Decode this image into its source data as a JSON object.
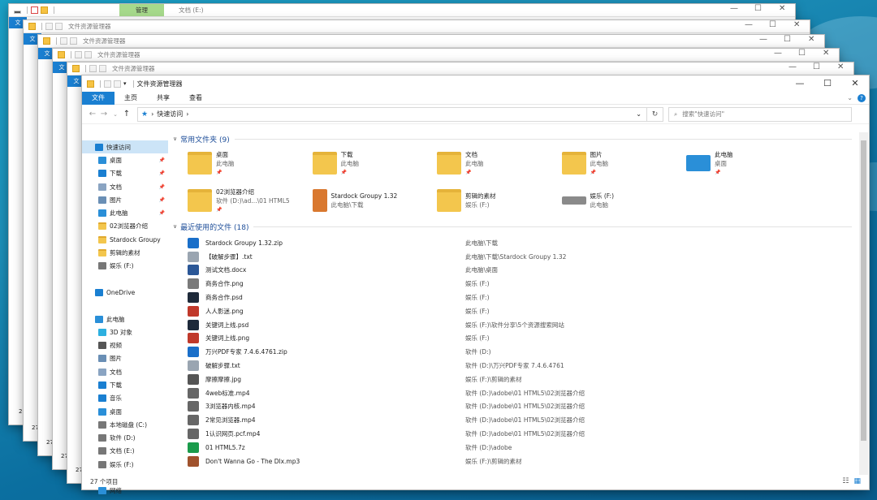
{
  "colors": {
    "accent": "#1a7fd1",
    "group_header": "#1e4e99",
    "manage_tab": "#a6d98b"
  },
  "back_window": {
    "manage_label": "管理",
    "title": "文档 (E:)"
  },
  "stack_tab": "文",
  "stack_title": "文件资源管理器",
  "main": {
    "title": "文件资源管理器",
    "ribbon_tabs": [
      "文件",
      "主页",
      "共享",
      "查看"
    ],
    "address": {
      "back": "←",
      "forward": "→",
      "recent": "⌄",
      "up": "↑",
      "path_root": "快速访问",
      "path_chevron": "›",
      "dropdown": "⌄",
      "refresh": "↻",
      "search_placeholder": "搜索\"快速访问\""
    },
    "controls": {
      "minimize": "—",
      "maximize": "☐",
      "close": "✕"
    }
  },
  "sidebar": {
    "items": [
      {
        "label": "快速访问",
        "icon": "star-icon",
        "pinned": false,
        "selected": true
      },
      {
        "label": "桌面",
        "icon": "desktop-icon",
        "pinned": true
      },
      {
        "label": "下载",
        "icon": "download-icon",
        "pinned": true
      },
      {
        "label": "文档",
        "icon": "document-icon",
        "pinned": true
      },
      {
        "label": "图片",
        "icon": "picture-icon",
        "pinned": true
      },
      {
        "label": "此电脑",
        "icon": "computer-icon",
        "pinned": true
      },
      {
        "label": "02浏览器介绍",
        "icon": "folder-icon"
      },
      {
        "label": "Stardock Groupy",
        "icon": "folder-icon"
      },
      {
        "label": "剪辑的素材",
        "icon": "folder-icon"
      },
      {
        "label": "娱乐 (F:)",
        "icon": "drive-icon"
      },
      {
        "label": "",
        "icon": ""
      },
      {
        "label": "OneDrive",
        "icon": "cloud-icon"
      },
      {
        "label": "",
        "icon": ""
      },
      {
        "label": "此电脑",
        "icon": "computer-icon"
      },
      {
        "label": "3D 对象",
        "icon": "cube-icon"
      },
      {
        "label": "视频",
        "icon": "video-icon"
      },
      {
        "label": "图片",
        "icon": "picture-icon"
      },
      {
        "label": "文档",
        "icon": "document-icon"
      },
      {
        "label": "下载",
        "icon": "download-icon"
      },
      {
        "label": "音乐",
        "icon": "music-icon"
      },
      {
        "label": "桌面",
        "icon": "desktop-icon"
      },
      {
        "label": "本地磁盘 (C:)",
        "icon": "drive-icon"
      },
      {
        "label": "软件 (D:)",
        "icon": "drive-icon"
      },
      {
        "label": "文档 (E:)",
        "icon": "drive-icon"
      },
      {
        "label": "娱乐 (F:)",
        "icon": "drive-icon"
      },
      {
        "label": "",
        "icon": ""
      },
      {
        "label": "网络",
        "icon": "network-icon"
      }
    ]
  },
  "frequent": {
    "header": "常用文件夹 (9)",
    "tiles": [
      {
        "name": "桌面",
        "sub": "此电脑",
        "pin": "📌"
      },
      {
        "name": "下载",
        "sub": "此电脑",
        "pin": "📌"
      },
      {
        "name": "文档",
        "sub": "此电脑",
        "pin": "📌"
      },
      {
        "name": "图片",
        "sub": "此电脑",
        "pin": "📌"
      },
      {
        "name": "此电脑",
        "sub": "桌面",
        "pin": "📌"
      },
      {
        "name": "02浏览器介绍",
        "sub": "软件 (D:)\\ad...\\01 HTML5",
        "pin": "📌"
      },
      {
        "name": "Stardock Groupy 1.32",
        "sub": "此电脑\\下载",
        "pin": ""
      },
      {
        "name": "剪辑的素材",
        "sub": "娱乐 (F:)",
        "pin": ""
      },
      {
        "name": "娱乐 (F:)",
        "sub": "此电脑",
        "pin": ""
      }
    ]
  },
  "recent": {
    "header": "最近使用的文件 (18)",
    "rows": [
      {
        "name": "Stardock Groupy 1.32.zip",
        "path": "此电脑\\下载",
        "icon": "zip-icon",
        "color": "#1a6fc9"
      },
      {
        "name": "【破解步骤】.txt",
        "path": "此电脑\\下载\\Stardock Groupy 1.32",
        "icon": "txt-icon",
        "color": "#9aa5b1"
      },
      {
        "name": "测试文档.docx",
        "path": "此电脑\\桌面",
        "icon": "word-icon",
        "color": "#2b5797"
      },
      {
        "name": "商务合作.png",
        "path": "娱乐 (F:)",
        "icon": "png-icon",
        "color": "#7a7a7a"
      },
      {
        "name": "商务合作.psd",
        "path": "娱乐 (F:)",
        "icon": "psd-icon",
        "color": "#1e2a3a"
      },
      {
        "name": "人人影迷.png",
        "path": "娱乐 (F:)",
        "icon": "png-icon",
        "color": "#c0392b"
      },
      {
        "name": "关键词上线.psd",
        "path": "娱乐 (F:)\\软件分享\\5个资源搜索网站",
        "icon": "psd-icon",
        "color": "#1e2a3a"
      },
      {
        "name": "关键词上线.png",
        "path": "娱乐 (F:)",
        "icon": "png-icon",
        "color": "#c0392b"
      },
      {
        "name": "万兴PDF专家 7.4.6.4761.zip",
        "path": "软件 (D:)",
        "icon": "zip-icon",
        "color": "#1a6fc9"
      },
      {
        "name": "破解步骤.txt",
        "path": "软件 (D:)\\万兴PDF专家 7.4.6.4761",
        "icon": "txt-icon",
        "color": "#9aa5b1"
      },
      {
        "name": "摩擦摩擦.jpg",
        "path": "娱乐 (F:)\\剪辑的素材",
        "icon": "jpg-icon",
        "color": "#555"
      },
      {
        "name": "4web标准.mp4",
        "path": "软件 (D:)\\adobe\\01 HTML5\\02浏览器介绍",
        "icon": "video-icon",
        "color": "#666"
      },
      {
        "name": "3浏览器内核.mp4",
        "path": "软件 (D:)\\adobe\\01 HTML5\\02浏览器介绍",
        "icon": "video-icon",
        "color": "#666"
      },
      {
        "name": "2常见浏览器.mp4",
        "path": "软件 (D:)\\adobe\\01 HTML5\\02浏览器介绍",
        "icon": "video-icon",
        "color": "#666"
      },
      {
        "name": "1认识网页.pcf.mp4",
        "path": "软件 (D:)\\adobe\\01 HTML5\\02浏览器介绍",
        "icon": "video-icon",
        "color": "#666"
      },
      {
        "name": "01 HTML5.7z",
        "path": "软件 (D:)\\adobe",
        "icon": "7z-icon",
        "color": "#1a9b4b"
      },
      {
        "name": "Don't Wanna Go  - The Dlx.mp3",
        "path": "娱乐 (F:)\\剪辑的素材",
        "icon": "audio-icon",
        "color": "#a0522d"
      }
    ]
  },
  "status": {
    "count": "27 个项目"
  },
  "stack_counts": [
    "20",
    "27",
    "27",
    "27",
    "27",
    "27"
  ],
  "view_icons": {
    "details": "☷",
    "tiles": "▦"
  },
  "help": "?",
  "ribbon_collapse": "⌄"
}
